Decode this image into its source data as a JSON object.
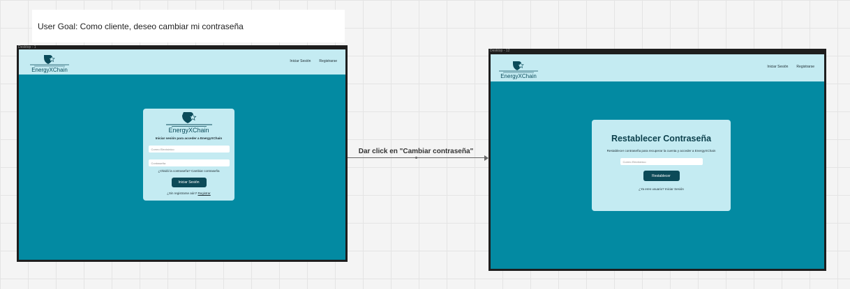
{
  "goal": {
    "text": "User Goal: Como cliente, deseo cambiar mi contraseña"
  },
  "frame1": {
    "label": "Desktop - 1",
    "brand": "EnergyXChain",
    "nav": {
      "login": "Iniciar Sesión",
      "register": "Registrarse"
    },
    "card": {
      "brand": "EnergyXChain",
      "heading": "Iniciar sesión para acceder a EnergyXChain",
      "email_placeholder": "Correo Electrónico",
      "password_placeholder": "Contraseña",
      "forgot_text": "¿Olvidó la contraseña?",
      "forgot_link": "Cambiar contraseña",
      "submit": "Iniciar Sesión",
      "signup_text": "¿Sin registrarse aún?",
      "signup_link": "Registrar"
    }
  },
  "arrow": {
    "label": "Dar click en \"Cambiar contraseña\""
  },
  "frame2": {
    "label": "Desktop - 12",
    "brand": "EnergyXChain",
    "nav": {
      "login": "Iniciar Sesión",
      "register": "Registrarse"
    },
    "card": {
      "title": "Restablecer Contraseña",
      "subtitle": "Restablecer contraseña para recuperar la cuenta y acceder a EnergyXChain",
      "email_placeholder": "Correo Electrónico",
      "submit": "Restablecer",
      "back_text": "¿Ya eres usuario?",
      "back_link": "Iniciar Sesión"
    }
  },
  "colors": {
    "screen": "#038aa2",
    "nav": "#c4ebf2",
    "button": "#0c4a58",
    "frame": "#1e1e1e"
  },
  "icons": {
    "logo": "shield-star-logo-icon"
  }
}
